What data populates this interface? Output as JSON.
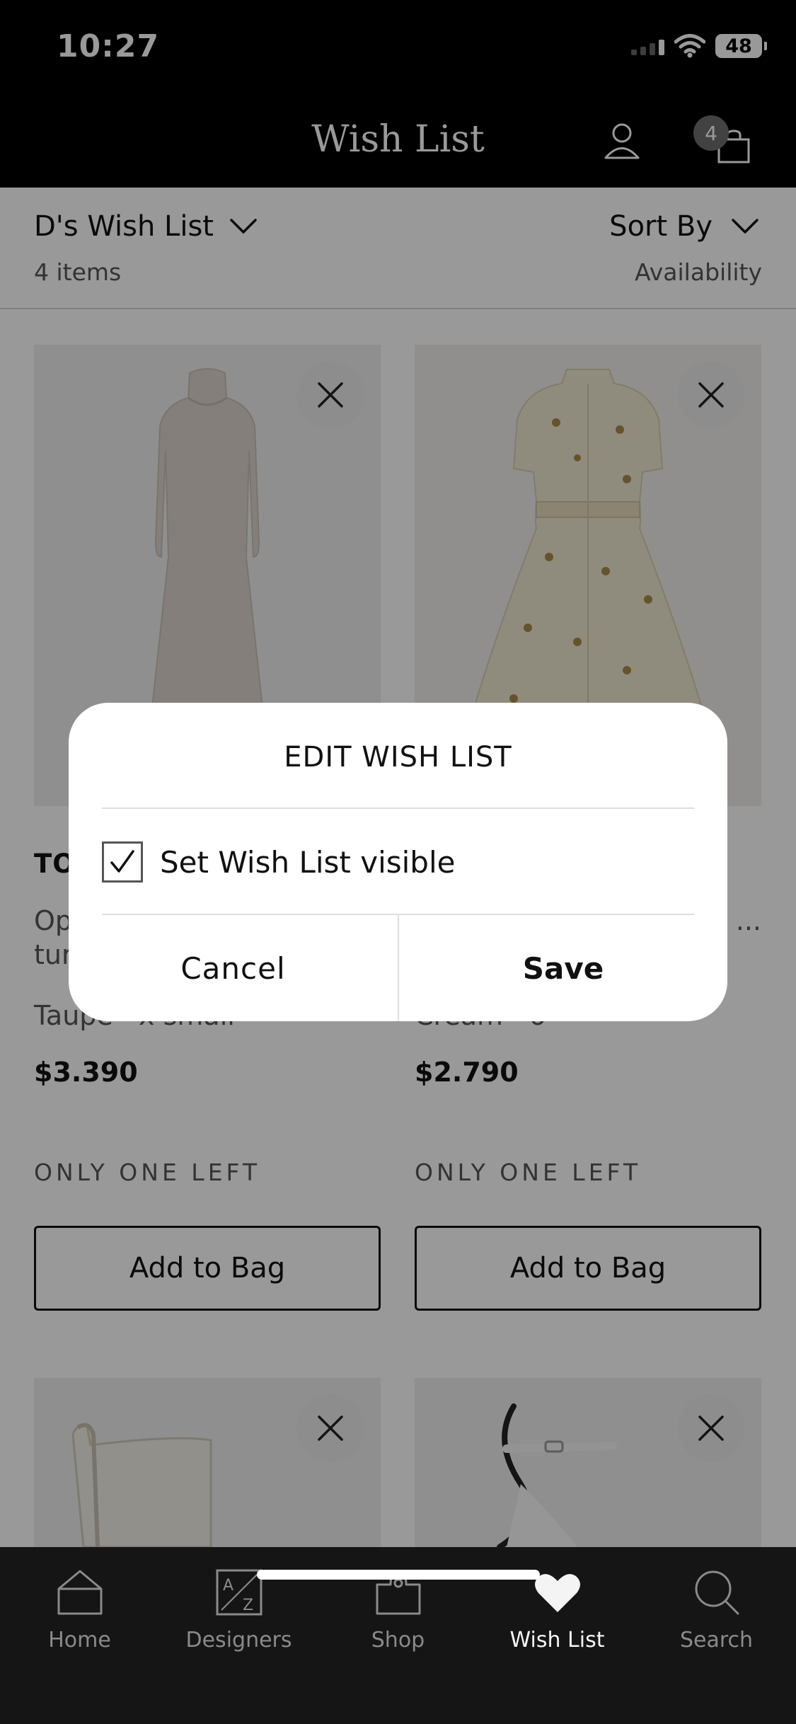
{
  "status_bar": {
    "time": "10:27",
    "battery": "48"
  },
  "nav": {
    "title": "Wish List",
    "bag_count": "4"
  },
  "list_header": {
    "list_name": "D's Wish List",
    "item_count": "4 items",
    "sort_label": "Sort By",
    "sort_value": "Availability"
  },
  "products": [
    {
      "brand": "TO",
      "name": "Op",
      "name_line2": "tur",
      "variant": "Taupe · x small",
      "price": "$3.390",
      "stock_note": "ONLY ONE LEFT",
      "add_label": "Add to Bag"
    },
    {
      "brand": "",
      "name": "",
      "name_line2": "...",
      "variant": "Cream · 6",
      "price": "$2.790",
      "stock_note": "ONLY ONE LEFT",
      "add_label": "Add to Bag"
    }
  ],
  "modal": {
    "title": "EDIT WISH LIST",
    "option_label": "Set Wish List visible",
    "option_checked": true,
    "cancel_label": "Cancel",
    "save_label": "Save"
  },
  "tab_bar": {
    "items": [
      {
        "label": "Home",
        "icon": "home-icon",
        "active": false
      },
      {
        "label": "Designers",
        "icon": "az-icon",
        "active": false
      },
      {
        "label": "Shop",
        "icon": "shopping-bag-icon",
        "active": false
      },
      {
        "label": "Wish List",
        "icon": "heart-icon",
        "active": true
      },
      {
        "label": "Search",
        "icon": "search-icon",
        "active": false
      }
    ]
  },
  "colors": {
    "dim_overlay": "rgba(0,0,0,0.40)",
    "nav_background": "#000000",
    "tab_active": "#f4f4f4",
    "tab_inactive": "#8a8a8a"
  }
}
